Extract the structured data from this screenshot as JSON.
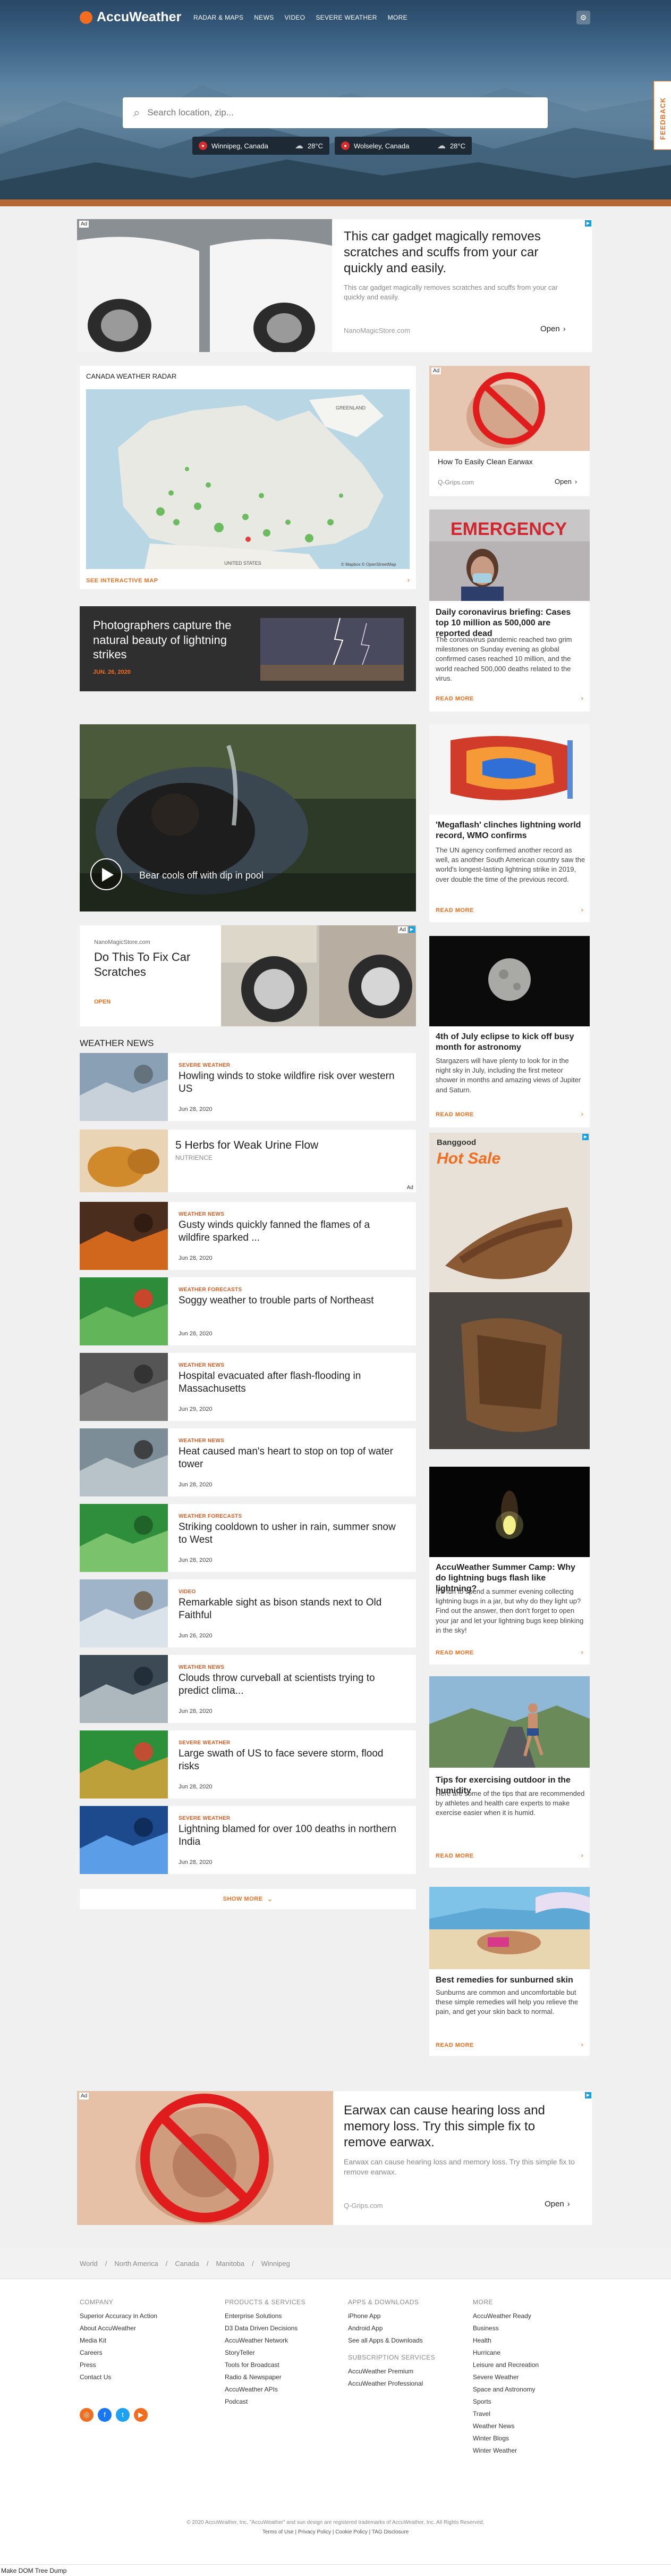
{
  "brand": {
    "name": "AccuWeather"
  },
  "nav": {
    "items": [
      "RADAR & MAPS",
      "NEWS",
      "VIDEO",
      "SEVERE WEATHER",
      "MORE"
    ]
  },
  "feedback_label": "FEEDBACK",
  "search": {
    "placeholder": "Search location, zip..."
  },
  "recent_locations": [
    {
      "name": "Winnipeg, Canada",
      "temp": "28°C"
    },
    {
      "name": "Wolseley, Canada",
      "temp": "28°C"
    }
  ],
  "top_ad": {
    "label": "Ad",
    "headline": "This car gadget magically removes scratches and scuffs from your car quickly and easily.",
    "body": "This car gadget magically removes scratches and scuffs from your car quickly and easily.",
    "source": "NanoMagicStore.com",
    "cta": "Open"
  },
  "radar": {
    "title": "CANADA WEATHER RADAR",
    "link": "SEE INTERACTIVE MAP",
    "map_label_greenland": "GREENLAND",
    "map_label_us": "UNITED STATES",
    "credit": "© Mapbox  © OpenStreetMap"
  },
  "side_ad1": {
    "label": "Ad",
    "headline": "How To Easily Clean Earwax",
    "source": "Q-Grips.com",
    "cta": "Open"
  },
  "photo_feature": {
    "title": "Photographers capture the natural beauty of lightning strikes",
    "date": "JUN. 26, 2020"
  },
  "video_feature": {
    "title": "Bear cools off with dip in pool"
  },
  "mid_ad": {
    "label": "Ad",
    "source": "NanoMagicStore.com",
    "headline": "Do This To Fix Car Scratches",
    "cta": "OPEN"
  },
  "sidebar_stories": [
    {
      "banner": "EMERGENCY",
      "title": "Daily coronavirus briefing: Cases top 10 million as 500,000 are reported dead",
      "body": "The coronavirus pandemic reached two grim milestones on Sunday evening as global confirmed cases reached 10 million, and the world reached 500,000 deaths related to the virus.",
      "cta": "READ MORE"
    },
    {
      "title": "'Megaflash' clinches lightning world record, WMO confirms",
      "body": "The UN agency confirmed another record as well, as another South American country saw the world's longest-lasting lightning strike in 2019, over double the time of the previous record.",
      "cta": "READ MORE"
    },
    {
      "title": "4th of July eclipse to kick off busy month for astronomy",
      "body": "Stargazers will have plenty to look for in the night sky in July, including the first meteor shower in months and amazing views of Jupiter and Saturn.",
      "cta": "READ MORE"
    },
    {
      "title": "AccuWeather Summer Camp: Why do lightning bugs flash like lightning?",
      "body": "It's fun to spend a summer evening collecting lightning bugs in a jar, but why do they light up? Find out the answer, then don't forget to open your jar and let your lightning bugs keep blinking in the sky!",
      "cta": "READ MORE"
    },
    {
      "title": "Tips for exercising outdoor in the humidity",
      "body": "Here are some of the tips that are recommended by athletes and health care experts to make exercise easier when it is humid.",
      "cta": "READ MORE"
    },
    {
      "title": "Best remedies for sunburned skin",
      "body": "Sunburns are common and uncomfortable but these simple remedies will help you relieve the pain, and get your skin back to normal.",
      "cta": "READ MORE"
    }
  ],
  "side_ad2": {
    "brand": "Banggood",
    "headline": "Hot Sale"
  },
  "weather_news": {
    "heading": "WEATHER NEWS",
    "items": [
      {
        "tag": "SEVERE WEATHER",
        "title": "Howling winds to stoke wildfire risk over western US",
        "date": "Jun 28, 2020"
      },
      {
        "tag": "WEATHER NEWS",
        "title": "Gusty winds quickly fanned the flames of a wildfire sparked ...",
        "date": "Jun 28, 2020"
      },
      {
        "tag": "WEATHER FORECASTS",
        "title": "Soggy weather to trouble parts of Northeast",
        "date": "Jun 28, 2020"
      },
      {
        "tag": "WEATHER NEWS",
        "title": "Hospital evacuated after flash-flooding in Massachusetts",
        "date": "Jun 29, 2020"
      },
      {
        "tag": "WEATHER NEWS",
        "title": "Heat caused man's heart to stop on top of water tower",
        "date": "Jun 28, 2020"
      },
      {
        "tag": "WEATHER FORECASTS",
        "title": "Striking cooldown to usher in rain, summer snow to West",
        "date": "Jun 28, 2020"
      },
      {
        "tag": "VIDEO",
        "title": "Remarkable sight as bison stands next to Old Faithful",
        "date": "Jun 26, 2020"
      },
      {
        "tag": "WEATHER NEWS",
        "title": "Clouds throw curveball at scientists trying to predict clima...",
        "date": "Jun 28, 2020"
      },
      {
        "tag": "SEVERE WEATHER",
        "title": "Large swath of US to face severe storm, flood risks",
        "date": "Jun 28, 2020"
      },
      {
        "tag": "SEVERE WEATHER",
        "title": "Lightning blamed for over 100 deaths in northern India",
        "date": "Jun 28, 2020"
      }
    ],
    "show_more": "SHOW MORE"
  },
  "inline_ad": {
    "label": "Ad",
    "headline": "5 Herbs for Weak Urine Flow",
    "source": "NUTRIENCE"
  },
  "bottom_ad": {
    "label": "Ad",
    "headline": "Earwax can cause hearing loss and memory loss. Try this simple fix to remove earwax.",
    "body": "Earwax can cause hearing loss and memory loss. Try this simple fix to remove earwax.",
    "source": "Q-Grips.com",
    "cta": "Open"
  },
  "breadcrumb": [
    "World",
    "North America",
    "Canada",
    "Manitoba",
    "Winnipeg"
  ],
  "footer": {
    "company": {
      "heading": "COMPANY",
      "links": [
        "Superior Accuracy in Action",
        "About AccuWeather",
        "Media Kit",
        "Careers",
        "Press",
        "Contact Us"
      ]
    },
    "products": {
      "heading": "PRODUCTS & SERVICES",
      "links": [
        "Enterprise Solutions",
        "D3 Data Driven Decisions",
        "AccuWeather Network",
        "StoryTeller",
        "Tools for Broadcast",
        "Radio & Newspaper",
        "AccuWeather APIs",
        "Podcast"
      ]
    },
    "apps": {
      "heading": "APPS & DOWNLOADS",
      "links": [
        "iPhone App",
        "Android App",
        "See all Apps & Downloads"
      ]
    },
    "subscription": {
      "heading": "SUBSCRIPTION SERVICES",
      "links": [
        "AccuWeather Premium",
        "AccuWeather Professional"
      ]
    },
    "more": {
      "heading": "MORE",
      "links": [
        "AccuWeather Ready",
        "Business",
        "Health",
        "Hurricane",
        "Leisure and Recreation",
        "Severe Weather",
        "Space and Astronomy",
        "Sports",
        "Travel",
        "Weather News",
        "Winter Blogs",
        "Winter Weather"
      ]
    },
    "copyright": "© 2020 AccuWeather, Inc. \"AccuWeather\" and sun design are registered trademarks of AccuWeather, Inc. All Rights Reserved.",
    "legal": "Terms of Use | Privacy Policy | Cookie Policy | TAG Disclosure"
  },
  "status_bar": "Make DOM Tree Dump"
}
